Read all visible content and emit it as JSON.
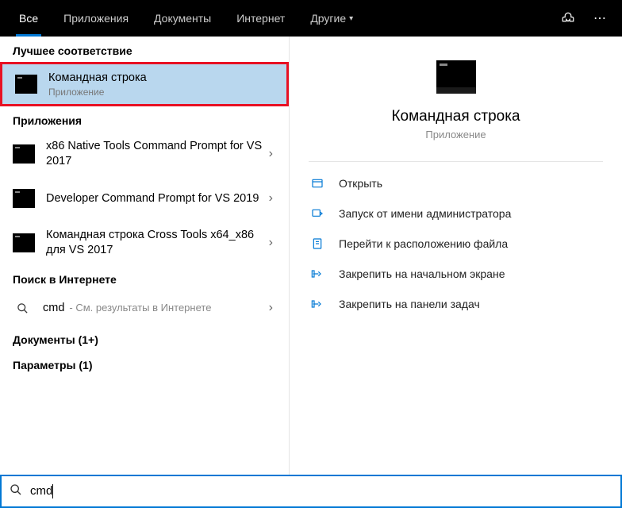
{
  "tabs": {
    "all": "Все",
    "apps": "Приложения",
    "docs": "Документы",
    "internet": "Интернет",
    "other": "Другие"
  },
  "sections": {
    "best_match": "Лучшее соответствие",
    "applications": "Приложения",
    "web_search": "Поиск в Интернете",
    "documents": "Документы (1+)",
    "settings": "Параметры (1)"
  },
  "best": {
    "title": "Командная строка",
    "subtitle": "Приложение"
  },
  "apps": [
    {
      "title": "x86 Native Tools Command Prompt for VS 2017"
    },
    {
      "title": "Developer Command Prompt for VS 2019"
    },
    {
      "title": "Командная строка Cross Tools x64_x86 для VS 2017"
    }
  ],
  "web": {
    "query": "cmd",
    "hint": "- См. результаты в Интернете"
  },
  "preview": {
    "title": "Командная строка",
    "subtitle": "Приложение"
  },
  "actions": {
    "open": "Открыть",
    "run_admin": "Запуск от имени администратора",
    "open_location": "Перейти к расположению файла",
    "pin_start": "Закрепить на начальном экране",
    "pin_taskbar": "Закрепить на панели задач"
  },
  "search": {
    "value": "cmd"
  }
}
